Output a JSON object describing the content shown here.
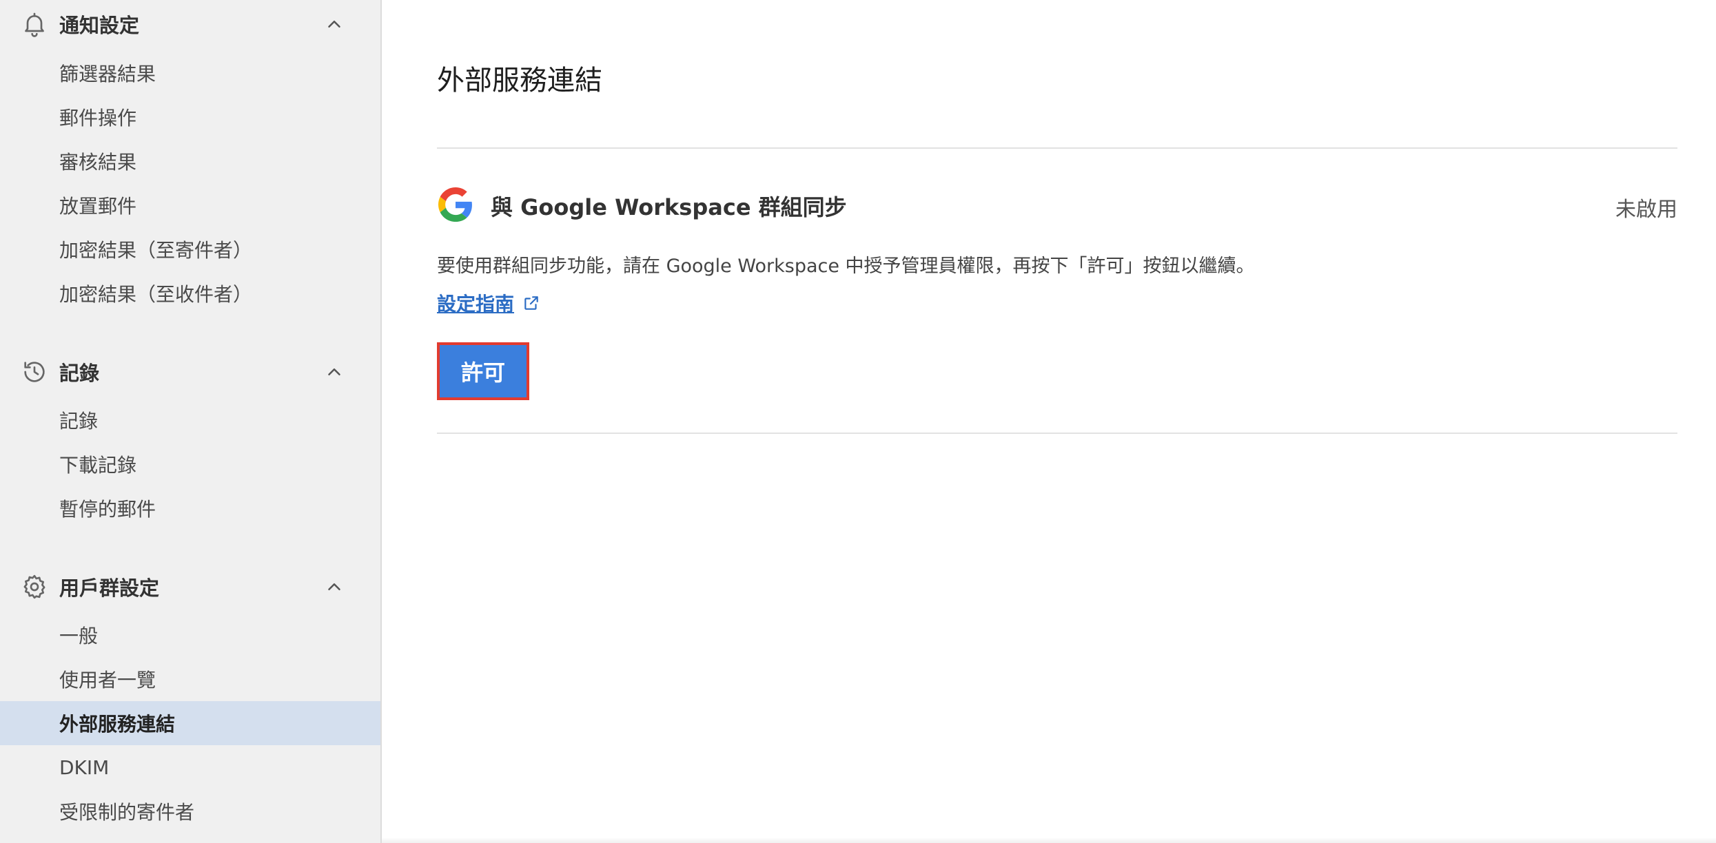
{
  "sidebar": {
    "groups": [
      {
        "icon": "bell-icon",
        "title": "通知設定",
        "expanded": true,
        "items": [
          {
            "label": "篩選器結果"
          },
          {
            "label": "郵件操作"
          },
          {
            "label": "審核結果"
          },
          {
            "label": "放置郵件"
          },
          {
            "label": "加密結果（至寄件者）"
          },
          {
            "label": "加密結果（至收件者）"
          }
        ]
      },
      {
        "icon": "history-icon",
        "title": "記錄",
        "expanded": true,
        "items": [
          {
            "label": "記錄"
          },
          {
            "label": "下載記錄"
          },
          {
            "label": "暫停的郵件"
          }
        ]
      },
      {
        "icon": "gear-icon",
        "title": "用戶群設定",
        "expanded": true,
        "items": [
          {
            "label": "一般"
          },
          {
            "label": "使用者一覽"
          },
          {
            "label": "外部服務連結",
            "active": true
          },
          {
            "label": "DKIM"
          },
          {
            "label": "受限制的寄件者"
          }
        ]
      }
    ]
  },
  "main": {
    "page_title": "外部服務連結",
    "service": {
      "logo": "google-g-icon",
      "title": "與 Google Workspace 群組同步",
      "status": "未啟用",
      "description": "要使用群組同步功能，請在 Google Workspace 中授予管理員權限，再按下「許可」按鈕以繼續。",
      "guide_link": "設定指南",
      "guide_link_icon": "external-link-icon",
      "allow_button": "許可"
    }
  },
  "colors": {
    "sidebar_bg": "#f0f0f0",
    "active_item_bg": "#d4dfee",
    "link": "#2b6cc4",
    "button_bg": "#3b7fdd",
    "button_highlight_border": "#e23b2f"
  }
}
